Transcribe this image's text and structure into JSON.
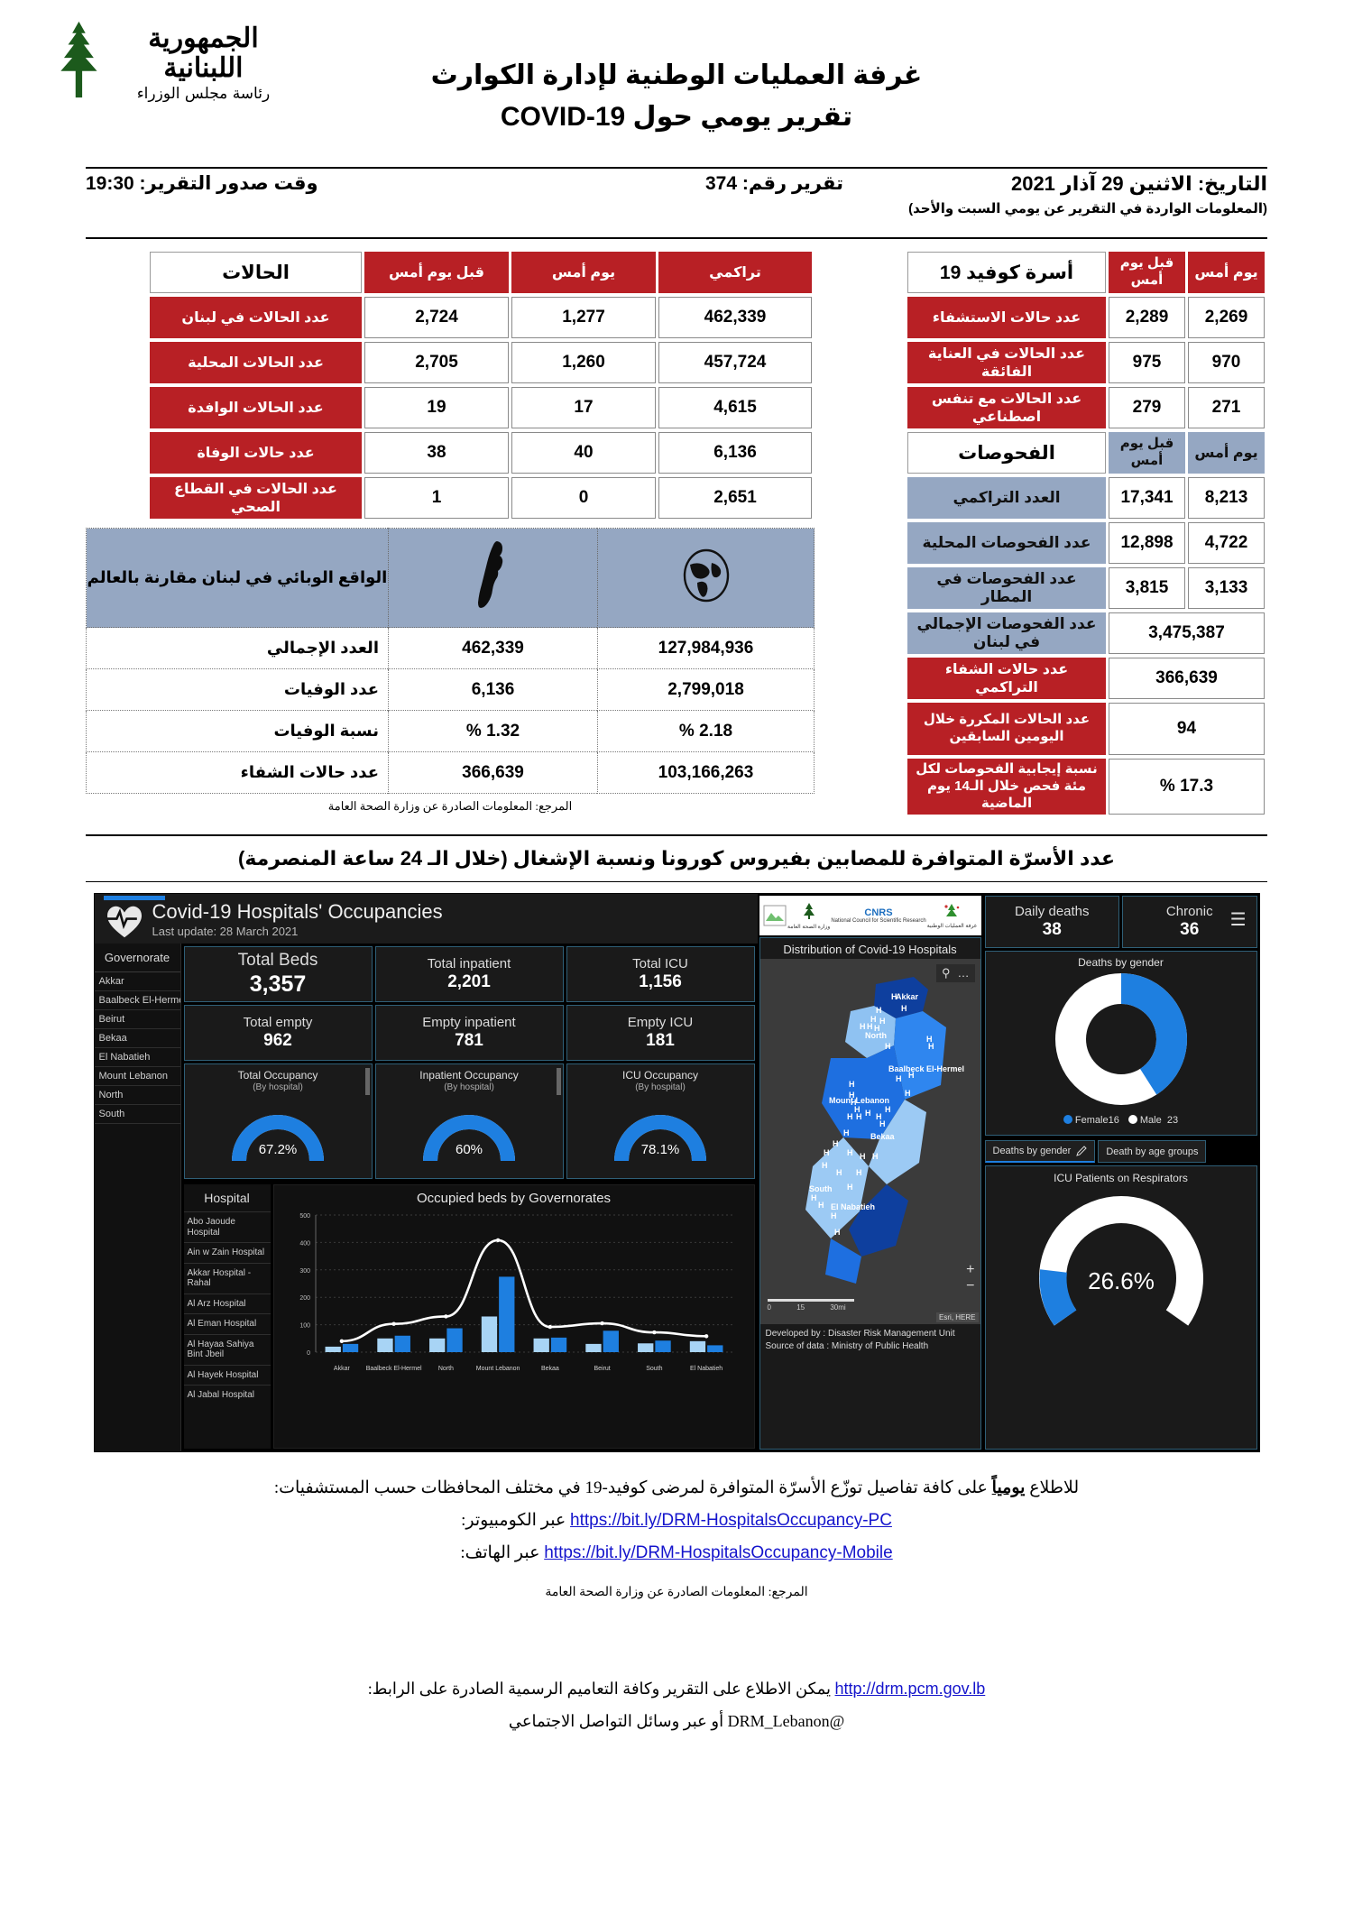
{
  "header": {
    "crest_line1": "الجمهورية اللبنانية",
    "crest_line2": "رئاسة مجلس الوزراء",
    "title_main": "غرفة العمليات الوطنية لإدارة الكوارث",
    "title_sub": "تقرير يومي حول COVID-19",
    "date_label": "التاريخ: الاثنين 29 آذار 2021",
    "date_note": "(المعلومات الواردة في التقرير عن يومي السبت والأحد)",
    "report_number": "تقرير رقم: 374",
    "issue_time": "وقت صدور التقرير: 19:30"
  },
  "cases_table": {
    "headers": {
      "label": "الحالات",
      "day_before_yesterday": "قبل يوم أمس",
      "yesterday": "يوم أمس",
      "cumulative": "تراكمي"
    },
    "rows": [
      {
        "label": "عدد الحالات في لبنان",
        "dby": "2,724",
        "yday": "1,277",
        "cum": "462,339"
      },
      {
        "label": "عدد الحالات المحلية",
        "dby": "2,705",
        "yday": "1,260",
        "cum": "457,724"
      },
      {
        "label": "عدد الحالات الوافدة",
        "dby": "19",
        "yday": "17",
        "cum": "4,615"
      },
      {
        "label": "عدد حالات الوفاة",
        "dby": "38",
        "yday": "40",
        "cum": "6,136"
      },
      {
        "label": "عدد الحالات في القطاع الصحي",
        "dby": "1",
        "yday": "0",
        "cum": "2,651"
      }
    ]
  },
  "beds_table": {
    "headers": {
      "label": "أسرة كوفيد 19",
      "day_before_yesterday": "قبل يوم أمس",
      "yesterday": "يوم أمس"
    },
    "rows": [
      {
        "label": "عدد حالات الاستشفاء",
        "dby": "2,289",
        "yday": "2,269"
      },
      {
        "label": "عدد الحالات في العناية الفائقة",
        "dby": "975",
        "yday": "970"
      },
      {
        "label": "عدد الحالات مع تنفس اصطناعي",
        "dby": "279",
        "yday": "271"
      }
    ]
  },
  "tests_table": {
    "headers": {
      "label": "الفحوصات",
      "day_before_yesterday": "قبل يوم أمس",
      "yesterday": "يوم أمس"
    },
    "rows": [
      {
        "label": "العدد التراكمي",
        "dby": "17,341",
        "yday": "8,213"
      },
      {
        "label": "عدد الفحوصات المحلية",
        "dby": "12,898",
        "yday": "4,722"
      },
      {
        "label": "عدد الفحوصات في المطار",
        "dby": "3,815",
        "yday": "3,133"
      }
    ],
    "wide_rows": [
      {
        "label": "عدد الفحوصات الإجمالي في لبنان",
        "value": "3,475,387",
        "style": "blue"
      },
      {
        "label": "عدد حالات الشفاء التراكمي",
        "value": "366,639",
        "style": "red"
      },
      {
        "label": "عدد الحالات المكررة خلال اليومين السابقين",
        "value": "94",
        "style": "red"
      },
      {
        "label": "نسبة إيجابية الفحوصات لكل مئة فحص خلال الـ14 يوم الماضية",
        "value": "17.3 %",
        "style": "red"
      }
    ]
  },
  "world_table": {
    "banner_label": "الواقع الوبائي في لبنان مقارنة بالعالم",
    "lebanon_icon": "lebanon-map-icon",
    "world_icon": "globe-icon",
    "rows": [
      {
        "label": "العدد الإجمالي",
        "lebanon": "462,339",
        "world": "127,984,936"
      },
      {
        "label": "عدد الوفيات",
        "lebanon": "6,136",
        "world": "2,799,018"
      },
      {
        "label": "نسبة الوفيات",
        "lebanon": "1.32 %",
        "world": "2.18 %"
      },
      {
        "label": "عدد حالات الشفاء",
        "lebanon": "366,639",
        "world": "103,166,263"
      }
    ]
  },
  "source_note": "المرجع: المعلومات الصادرة عن وزارة الصحة العامة",
  "section_title": "عدد الأسرّة المتوافرة للمصابين بفيروس كورونا ونسبة الإشغال (خلال الـ 24 ساعة المنصرمة)",
  "dashboard": {
    "title": "Covid-19 Hospitals' Occupancies",
    "last_update": "Last update: 28 March 2021",
    "menu_icon": "hamburger-icon",
    "heart_icon": "heart-pulse-icon",
    "governorate_header": "Governorate",
    "governorates": [
      "Akkar",
      "Baalbeck El-Hermel",
      "Beirut",
      "Bekaa",
      "El Nabatieh",
      "Mount Lebanon",
      "North",
      "South"
    ],
    "kpis": [
      {
        "label": "Total Beds",
        "value": "3,357"
      },
      {
        "label": "Total inpatient",
        "value": "2,201"
      },
      {
        "label": "Total ICU",
        "value": "1,156"
      },
      {
        "label": "Total empty",
        "value": "962"
      },
      {
        "label": "Empty inpatient",
        "value": "781"
      },
      {
        "label": "Empty ICU",
        "value": "181"
      }
    ],
    "gauges": [
      {
        "title": "Total Occupancy",
        "sub": "(By hospital)",
        "value": "67.2%",
        "pct": 67.2
      },
      {
        "title": "Inpatient Occupancy",
        "sub": "(By hospital)",
        "value": "60%",
        "pct": 60
      },
      {
        "title": "ICU Occupancy",
        "sub": "(By hospital)",
        "value": "78.1%",
        "pct": 78.1
      }
    ],
    "hospital_header": "Hospital",
    "hospitals": [
      "Abo Jaoude Hospital",
      "Ain w Zain Hospital",
      "Akkar Hospital - Rahal",
      "Al Arz Hospital",
      "Al Eman Hospital",
      "Al Hayaa Sahiya Bint Jbeil",
      "Al Hayek Hospital",
      "Al Jabal Hospital"
    ],
    "map_title": "Distribution of Covid-19 Hospitals",
    "map_search_icon": "search-icon",
    "map_more_icon": "more-options-icon",
    "map_zoom_in": "+",
    "map_zoom_out": "−",
    "map_attribution": "Esri, HERE",
    "map_scale_labels": [
      "0",
      "15",
      "30mi"
    ],
    "map_region_labels": [
      "Akkar",
      "North",
      "Baalbeck El-Hermel",
      "Mount Lebanon",
      "Bekaa",
      "South",
      "El Nabatieh"
    ],
    "map_developed_by": "Developed by :   Disaster Risk Management Unit",
    "map_source": "Source of data :   Ministry of Public Health",
    "right_kpis": [
      {
        "label": "Daily deaths",
        "value": "38"
      },
      {
        "label": "Chronic",
        "value": "36"
      }
    ],
    "donut_title": "Deaths by gender",
    "donut_legend": [
      {
        "name": "Female",
        "value": "16",
        "color": "#1e7fe0"
      },
      {
        "name": "Male",
        "value": "23",
        "color": "#ffffff"
      }
    ],
    "tabs": [
      {
        "label": "Deaths by gender",
        "icon": "pencil-icon",
        "active": true
      },
      {
        "label": "Death by age groups",
        "icon": "",
        "active": false
      }
    ],
    "respirator_title": "ICU Patients on Respirators",
    "respirator_value": "26.6%",
    "respirator_pct": 26.6,
    "logo_strip": [
      "broken-image-icon",
      "ministry-of-public-health-logo",
      "CNRS",
      "drm-logo"
    ],
    "logo_captions": [
      "",
      "وزارة الصحة العامة",
      "National Council for Scientific Research",
      "غرفة العمليات الوطنية"
    ]
  },
  "chart_data": {
    "type": "bar",
    "title": "Occupied beds by Governorates",
    "categories": [
      "Akkar",
      "Baalbeck El-Hermel",
      "North",
      "Mount Lebanon",
      "Bekaa",
      "Beirut",
      "South",
      "El Nabatieh"
    ],
    "series": [
      {
        "name": "Inpatient",
        "color": "#a8d4f5",
        "values": [
          20,
          50,
          50,
          130,
          50,
          30,
          32,
          40
        ]
      },
      {
        "name": "ICU",
        "color": "#1e7fe0",
        "values": [
          30,
          60,
          87,
          275,
          53,
          78,
          42,
          25
        ]
      }
    ],
    "line": {
      "name": "Total",
      "color": "#ffffff",
      "values": [
        40,
        103,
        130,
        408,
        92,
        105,
        72,
        58
      ]
    },
    "ylabel": "",
    "xlabel": "",
    "ylim": [
      0,
      500
    ],
    "yticks": [
      0,
      100,
      200,
      300,
      400,
      500
    ],
    "grid": true,
    "legend": "none"
  },
  "links": {
    "intro_prefix": "للاطلاع ",
    "intro_bold": "يومياً",
    "intro_rest": " على كافة تفاصيل توزّع الأسرّة المتوافرة لمرضى كوفيد-19 في مختلف المحافظات حسب المستشفيات:",
    "pc_label": "عبر الكومبيوتر:",
    "pc_url": "https://bit.ly/DRM-HospitalsOccupancy-PC",
    "mobile_label": "عبر الهاتف:",
    "mobile_url": "https://bit.ly/DRM-HospitalsOccupancy-Mobile",
    "source_note": "المرجع: المعلومات الصادرة عن وزارة الصحة العامة"
  },
  "footer": {
    "line1_prefix": "يمكن الاطلاع على التقرير وكافة التعاميم الرسمية الصادرة على الرابط:",
    "site_url": "http://drm.pcm.gov.lb",
    "line2_prefix": "أو عبر وسائل التواصل الاجتماعي",
    "handle": "@DRM_Lebanon"
  },
  "colors": {
    "red": "#b82025",
    "blue_grey": "#95a7c2",
    "dash_blue": "#1e7fe0",
    "link": "#1414cc"
  }
}
